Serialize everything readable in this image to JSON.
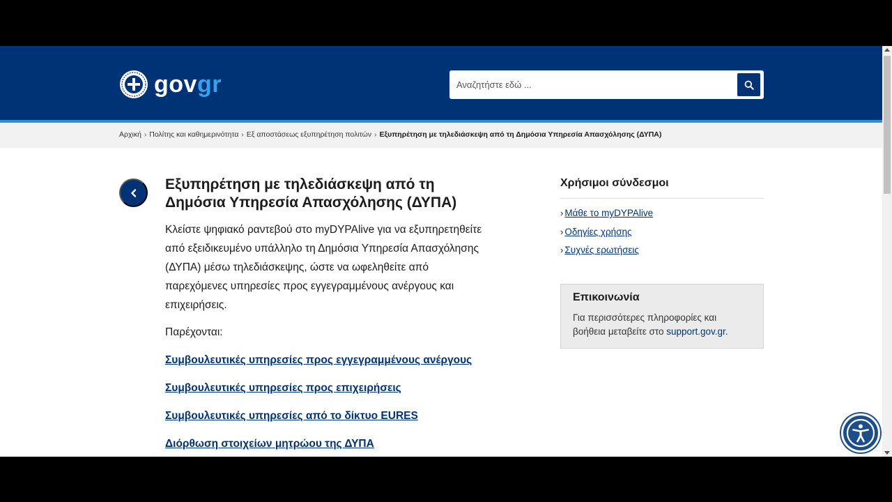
{
  "header": {
    "logo": {
      "text_gov": "gov",
      "text_gr": "gr"
    },
    "search": {
      "placeholder": "Αναζητήστε εδώ ..."
    },
    "colors": {
      "header_bg": "#003375",
      "accent": "#2f8cd8"
    }
  },
  "breadcrumb": {
    "items": [
      "Αρχική",
      "Πολίτης και καθημερινότητα",
      "Εξ αποστάσεως εξυπηρέτηση πολιτών"
    ],
    "current": "Εξυπηρέτηση με τηλεδιάσκεψη από τη Δημόσια Υπηρεσία Απασχόλησης (ΔΥΠΑ)"
  },
  "main": {
    "title": "Εξυπηρέτηση με τηλεδιάσκεψη από τη Δημόσια Υπηρεσία Απασχόλησης (ΔΥΠΑ)",
    "intro": "Κλείστε ψηφιακό ραντεβού στο myDYPAlive για να εξυπηρετηθείτε από εξειδικευμένο υπάλληλο τη Δημόσια Υπηρεσία Απασχόλησης (ΔΥΠΑ) μέσω τηλεδιάσκεψης, ώστε να ωφεληθείτε από παρεχόμενες υπηρεσίες προς εγγεγραμμένους ανέργους και επιχειρήσεις.",
    "provided_label": "Παρέχονται:",
    "services": [
      "Συμβουλευτικές υπηρεσίες προς εγγεγραμμένους ανέργους",
      "Συμβουλευτικές υπηρεσίες προς επιχειρήσεις",
      "Συμβουλευτικές υπηρεσίες από το δίκτυο EURES",
      "Διόρθωση στοιχείων μητρώου της ΔΥΠΑ"
    ]
  },
  "sidebar": {
    "heading": "Χρήσιμοι σύνδεσμοι",
    "links": [
      "Μάθε το myDYPAlive",
      "Οδηγίες χρήσης",
      "Συχνές ερωτήσεις"
    ],
    "contact": {
      "title": "Επικοινωνία",
      "text": "Για περισσότερες πληροφορίες και βοήθεια μεταβείτε στο",
      "link": "support.gov.gr",
      "suffix": "."
    }
  },
  "icons": {
    "back": "chevron-left-icon",
    "search": "search-icon",
    "accessibility": "accessibility-icon",
    "emblem": "greek-emblem-icon"
  }
}
